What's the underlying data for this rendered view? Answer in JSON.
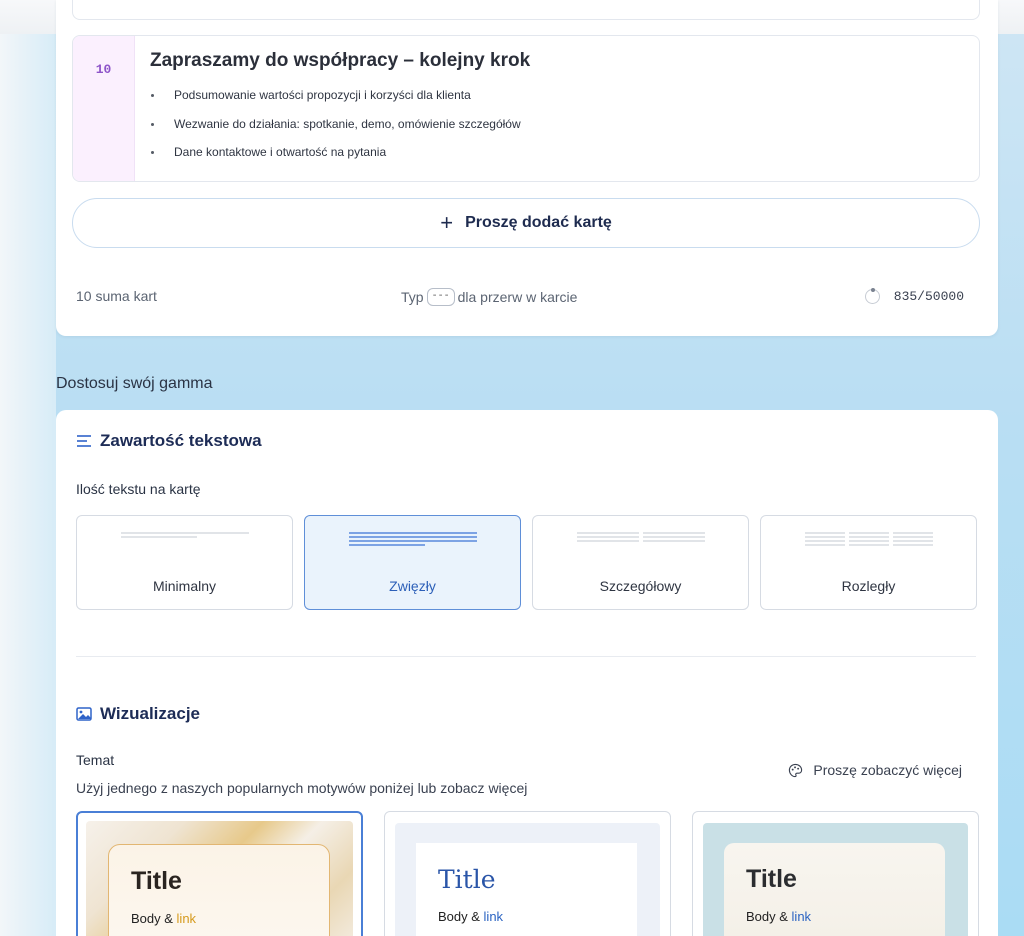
{
  "slide": {
    "number": "10",
    "title": "Zapraszamy do współpracy – kolejny krok",
    "bullets": [
      "Podsumowanie wartości propozycji i korzyści dla klienta",
      "Wezwanie do działania: spotkanie, demo, omówienie szczegółów",
      "Dane kontaktowe i otwartość na pytania"
    ]
  },
  "add_card": {
    "plus_icon": "plus-icon",
    "label": "Proszę dodać kartę"
  },
  "footer": {
    "total_cards": "10 suma kart",
    "hint_prefix": "Typ",
    "hint_key": "---",
    "hint_suffix": "dla przerw w karcie",
    "char_count": "835/50000"
  },
  "customize": {
    "heading": "Dostosuj swój gamma",
    "text_content": {
      "icon": "text-lines-icon",
      "title": "Zawartość tekstowa",
      "amount_label": "Ilość tekstu na kartę",
      "options": [
        {
          "label": "Minimalny",
          "selected": false
        },
        {
          "label": "Zwięzły",
          "selected": true
        },
        {
          "label": "Szczegółowy",
          "selected": false
        },
        {
          "label": "Rozległy",
          "selected": false
        }
      ]
    },
    "visuals": {
      "icon": "image-icon",
      "title": "Wizualizacje",
      "theme_label": "Temat",
      "theme_desc": "Użyj jednego z naszych popularnych motywów poniżej lub zobacz więcej",
      "see_more": "Proszę zobaczyć więcej",
      "themes": [
        {
          "title": "Title",
          "body": "Body &",
          "link": "link",
          "selected": true
        },
        {
          "title": "Title",
          "body": "Body &",
          "link": "link",
          "selected": false
        },
        {
          "title": "Title",
          "body": "Body &",
          "link": "link",
          "selected": false
        }
      ]
    }
  },
  "colors": {
    "accent": "#2f63c9",
    "selected_bg": "#eaf3fc",
    "slide_num_bg": "#fbf0fe",
    "link_gold": "#d59a1c",
    "link_blue": "#2a63c2"
  }
}
